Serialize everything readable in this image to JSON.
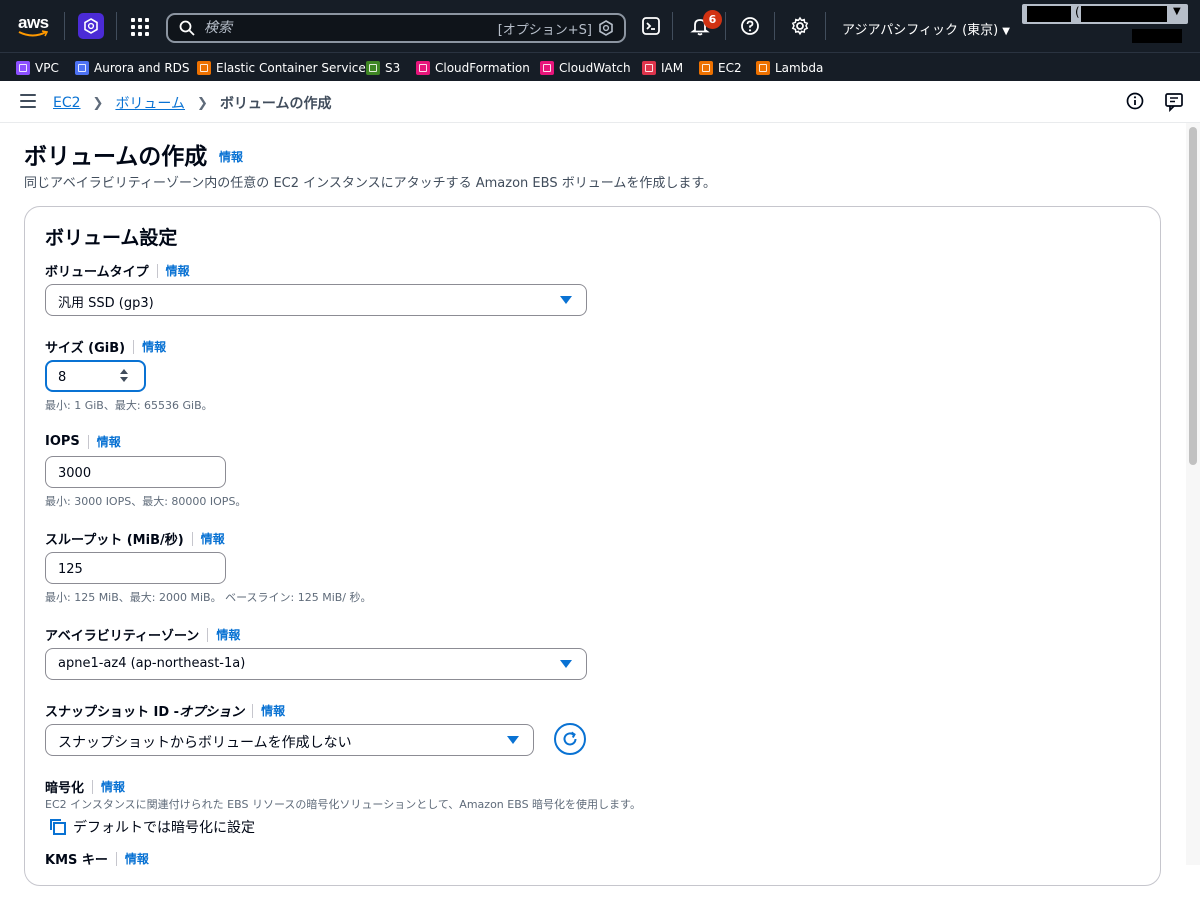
{
  "topnav": {
    "logo_text": "aws",
    "search_placeholder": "検索",
    "search_shortcut": "[オプション+S]",
    "notification_count": "6",
    "region_label": "アジアパシフィック (東京)",
    "account_paren": "("
  },
  "favorites": [
    {
      "label": "VPC",
      "color": "#8c4fff"
    },
    {
      "label": "Aurora and RDS",
      "color": "#4d72f3"
    },
    {
      "label": "Elastic Container Service",
      "color": "#ed7100"
    },
    {
      "label": "S3",
      "color": "#3f8624"
    },
    {
      "label": "CloudFormation",
      "color": "#e7157b"
    },
    {
      "label": "CloudWatch",
      "color": "#e7157b"
    },
    {
      "label": "IAM",
      "color": "#dd344c"
    },
    {
      "label": "EC2",
      "color": "#ed7100"
    },
    {
      "label": "Lambda",
      "color": "#ed7100"
    }
  ],
  "breadcrumb": {
    "items": [
      "EC2",
      "ボリューム"
    ],
    "current": "ボリュームの作成"
  },
  "page": {
    "title": "ボリュームの作成",
    "info": "情報",
    "description": "同じアベイラビリティーゾーン内の任意の EC2 インスタンスにアタッチする Amazon EBS ボリュームを作成します。"
  },
  "panel": {
    "title": "ボリューム設定",
    "volume_type": {
      "label": "ボリュームタイプ",
      "info": "情報",
      "value": "汎用 SSD (gp3)"
    },
    "size": {
      "label": "サイズ (GiB)",
      "info": "情報",
      "value": "8",
      "constraint": "最小: 1 GiB、最大: 65536 GiB。"
    },
    "iops": {
      "label": "IOPS",
      "info": "情報",
      "value": "3000",
      "constraint": "最小: 3000 IOPS、最大: 80000 IOPS。"
    },
    "throughput": {
      "label": "スループット (MiB/秒)",
      "info": "情報",
      "value": "125",
      "constraint": "最小: 125 MiB、最大: 2000 MiB。 ベースライン: 125 MiB/ 秒。"
    },
    "az": {
      "label": "アベイラビリティーゾーン",
      "info": "情報",
      "value": "apne1-az4 (ap-northeast-1a)"
    },
    "snapshot": {
      "label": "スナップショット ID - ",
      "label_optional": "オプション",
      "info": "情報",
      "value": "スナップショットからボリュームを作成しない"
    },
    "encryption": {
      "label": "暗号化",
      "info": "情報",
      "description": "EC2 インスタンスに関連付けられた EBS リソースの暗号化ソリューションとして、Amazon EBS 暗号化を使用します。",
      "checkbox_label": "デフォルトでは暗号化に設定"
    },
    "kms": {
      "label": "KMS キー",
      "info": "情報"
    }
  },
  "colors": {
    "accent": "#0972d3",
    "nav_bg": "#161d26",
    "badge": "#d13212"
  }
}
